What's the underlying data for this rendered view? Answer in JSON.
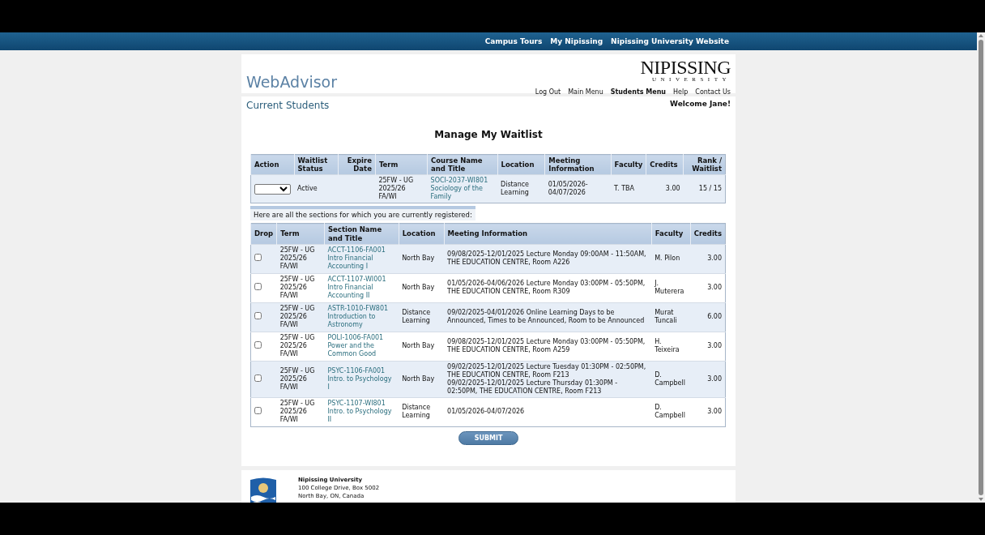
{
  "top_links": [
    "Campus Tours",
    "My Nipissing",
    "Nipissing University Website"
  ],
  "header": {
    "title": "WebAdvisor",
    "logo": {
      "name": "NIPISSING",
      "sub": "UNIVERSITY"
    },
    "nav": [
      {
        "label": "Log Out",
        "selected": false
      },
      {
        "label": "Main Menu",
        "selected": false
      },
      {
        "label": "Students Menu",
        "selected": true
      },
      {
        "label": "Help",
        "selected": false
      },
      {
        "label": "Contact Us",
        "selected": false
      }
    ]
  },
  "section_title": "Current Students",
  "welcome": "Welcome Jane!",
  "page_title": "Manage My Waitlist",
  "waitlist": {
    "columns": [
      "Action",
      "Waitlist Status",
      "Expire Date",
      "Term",
      "Course Name and Title",
      "Location",
      "Meeting Information",
      "Faculty",
      "Credits",
      "Rank / Waitlist"
    ],
    "rows": [
      {
        "status": "Active",
        "term": "25FW - UG 2025/26 FA/WI",
        "course_code": "SOCI-2037-WI801",
        "course_title": "Sociology of the Family",
        "location": "Distance Learning",
        "meeting": "01/05/2026-04/07/2026",
        "faculty": "T. TBA",
        "credits": "3.00",
        "rank": "15 / 15"
      }
    ]
  },
  "registered": {
    "caption": "Here are all the sections for which you are currently registered:",
    "columns": [
      "Drop",
      "Term",
      "Section Name and Title",
      "Location",
      "Meeting Information",
      "Faculty",
      "Credits"
    ],
    "rows": [
      {
        "checked": false,
        "term": "25FW - UG 2025/26 FA/WI",
        "section_code": "ACCT-1106-FA001",
        "section_title": "Intro Financial Accounting I",
        "location": "North Bay",
        "meeting": [
          "09/08/2025-12/01/2025 Lecture Monday 09:00AM - 11:50AM, THE EDUCATION CENTRE, Room A226"
        ],
        "faculty": "M. Pilon",
        "credits": "3.00"
      },
      {
        "checked": false,
        "term": "25FW - UG 2025/26 FA/WI",
        "section_code": "ACCT-1107-WI001",
        "section_title": "Intro Financial Accounting II",
        "location": "North Bay",
        "meeting": [
          "01/05/2026-04/06/2026 Lecture Monday 03:00PM - 05:50PM, THE EDUCATION CENTRE, Room R309"
        ],
        "faculty": "J. Muterera",
        "credits": "3.00"
      },
      {
        "checked": false,
        "term": "25FW - UG 2025/26 FA/WI",
        "section_code": "ASTR-1010-FW801",
        "section_title": "Introduction to Astronomy",
        "location": "Distance Learning",
        "meeting": [
          "09/02/2025-04/01/2026 Online Learning Days to be Announced, Times to be Announced, Room to be Announced"
        ],
        "faculty": "Murat Tuncali",
        "credits": "6.00"
      },
      {
        "checked": false,
        "term": "25FW - UG 2025/26 FA/WI",
        "section_code": "POLI-1006-FA001",
        "section_title": "Power and the Common Good",
        "location": "North Bay",
        "meeting": [
          "09/08/2025-12/01/2025 Lecture Monday 03:00PM - 05:50PM, THE EDUCATION CENTRE, Room A259"
        ],
        "faculty": "H. Teixeira",
        "credits": "3.00"
      },
      {
        "checked": false,
        "term": "25FW - UG 2025/26 FA/WI",
        "section_code": "PSYC-1106-FA001",
        "section_title": "Intro. to Psychology I",
        "location": "North Bay",
        "meeting": [
          "09/02/2025-12/01/2025 Lecture Tuesday 01:30PM - 02:50PM, THE EDUCATION CENTRE, Room F213",
          "09/02/2025-12/01/2025 Lecture Thursday 01:30PM - 02:50PM, THE EDUCATION CENTRE, Room F213"
        ],
        "faculty": "D. Campbell",
        "credits": "3.00"
      },
      {
        "checked": false,
        "term": "25FW - UG 2025/26 FA/WI",
        "section_code": "PSYC-1107-WI801",
        "section_title": "Intro. to Psychology II",
        "location": "Distance Learning",
        "meeting": [
          "01/05/2026-04/07/2026"
        ],
        "faculty": "D. Campbell",
        "credits": "3.00"
      }
    ]
  },
  "submit": "SUBMIT",
  "footer": {
    "name": "Nipissing University",
    "lines": [
      "100 College Drive, Box 5002",
      "North Bay, ON, Canada"
    ]
  }
}
